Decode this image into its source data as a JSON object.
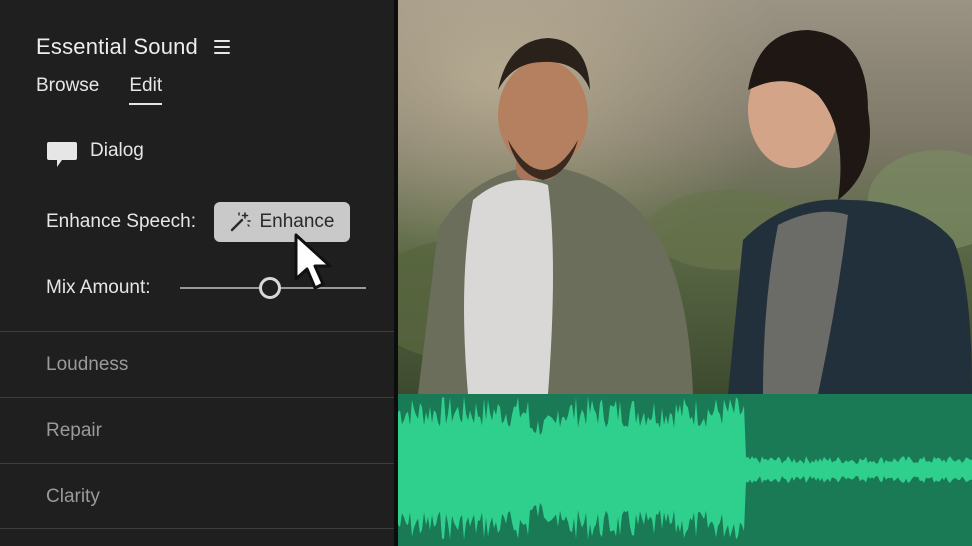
{
  "panel": {
    "title": "Essential Sound",
    "menu_icon": "hamburger-menu-icon",
    "tabs": [
      {
        "label": "Browse",
        "active": false
      },
      {
        "label": "Edit",
        "active": true
      }
    ],
    "dialog": {
      "icon": "speech-bubble-icon",
      "label": "Dialog"
    },
    "enhance": {
      "label": "Enhance Speech:",
      "button_label": "Enhance",
      "button_icon": "magic-wand-icon"
    },
    "mix": {
      "label": "Mix Amount:",
      "value_fraction": 0.48
    },
    "sections": [
      {
        "label": "Loudness"
      },
      {
        "label": "Repair"
      },
      {
        "label": "Clarity"
      }
    ]
  },
  "colors": {
    "panel_bg": "#1f1f1f",
    "button_bg": "#c9c9c9",
    "waveform_bg": "#1a7a55",
    "waveform_fill": "#2fd08e"
  }
}
